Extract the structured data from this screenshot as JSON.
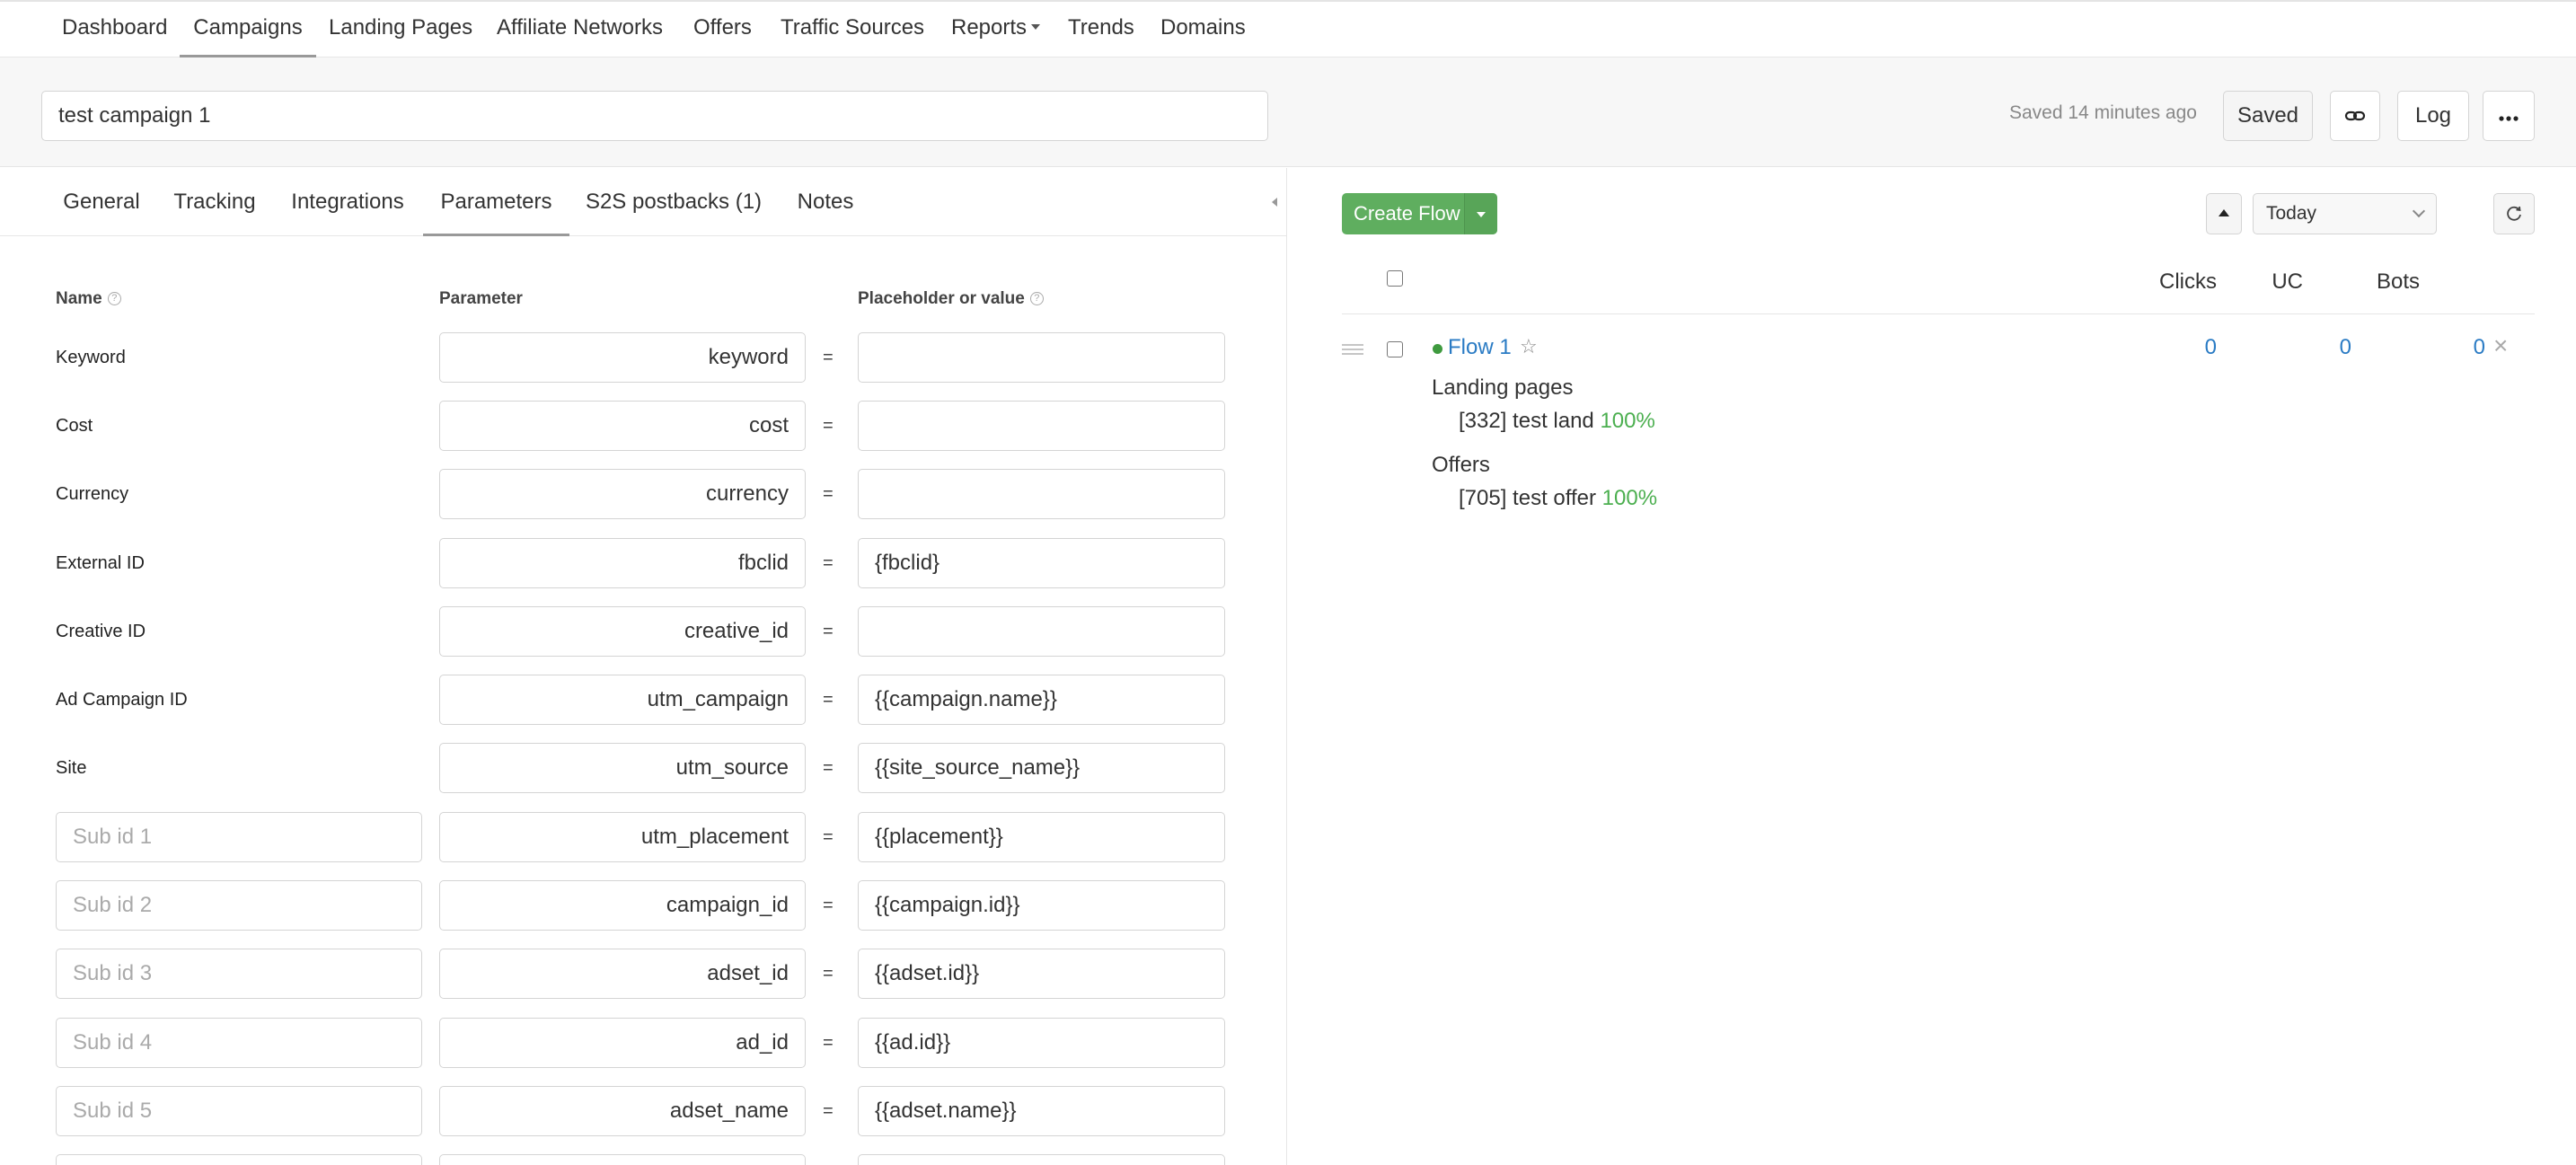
{
  "nav": {
    "items": [
      {
        "label": "Dashboard",
        "active": false
      },
      {
        "label": "Campaigns",
        "active": true
      },
      {
        "label": "Landing Pages",
        "active": false
      },
      {
        "label": "Affiliate Networks",
        "active": false
      },
      {
        "label": "Offers",
        "active": false
      },
      {
        "label": "Traffic Sources",
        "active": false
      },
      {
        "label": "Reports",
        "active": false,
        "dropdown": true
      },
      {
        "label": "Trends",
        "active": false
      },
      {
        "label": "Domains",
        "active": false
      }
    ]
  },
  "header": {
    "campaign_name": "test campaign 1",
    "saved_status": "Saved 14 minutes ago",
    "saved_button": "Saved",
    "link_icon": "link-icon",
    "log_button": "Log",
    "more_icon": "ellipsis-icon"
  },
  "tabs": [
    {
      "label": "General",
      "active": false
    },
    {
      "label": "Tracking",
      "active": false
    },
    {
      "label": "Integrations",
      "active": false
    },
    {
      "label": "Parameters",
      "active": true
    },
    {
      "label": "S2S postbacks (1)",
      "active": false
    },
    {
      "label": "Notes",
      "active": false
    }
  ],
  "params": {
    "headers": {
      "name": "Name",
      "parameter": "Parameter",
      "value": "Placeholder or value"
    },
    "equals": "=",
    "rows": [
      {
        "name": "Keyword",
        "parameter": "keyword",
        "value": ""
      },
      {
        "name": "Cost",
        "parameter": "cost",
        "value": ""
      },
      {
        "name": "Currency",
        "parameter": "currency",
        "value": ""
      },
      {
        "name": "External ID",
        "parameter": "fbclid",
        "value": "{fbclid}"
      },
      {
        "name": "Creative ID",
        "parameter": "creative_id",
        "value": ""
      },
      {
        "name": "Ad Campaign ID",
        "parameter": "utm_campaign",
        "value": "{{campaign.name}}"
      },
      {
        "name": "Site",
        "parameter": "utm_source",
        "value": "{{site_source_name}}"
      },
      {
        "placeholder": "Sub id 1",
        "parameter": "utm_placement",
        "value": "{{placement}}"
      },
      {
        "placeholder": "Sub id 2",
        "parameter": "campaign_id",
        "value": "{{campaign.id}}"
      },
      {
        "placeholder": "Sub id 3",
        "parameter": "adset_id",
        "value": "{{adset.id}}"
      },
      {
        "placeholder": "Sub id 4",
        "parameter": "ad_id",
        "value": "{{ad.id}}"
      },
      {
        "placeholder": "Sub id 5",
        "parameter": "adset_name",
        "value": "{{adset.name}}"
      }
    ]
  },
  "flows": {
    "create_button": "Create Flow",
    "period": "Today",
    "columns": [
      "Clicks",
      "UC",
      "Bots"
    ],
    "items": [
      {
        "name": "Flow 1",
        "status_color": "#3f9a3f",
        "clicks": "0",
        "uc": "0",
        "bots": "0",
        "landing_title": "Landing pages",
        "landing": {
          "text": "[332] test land",
          "pct": "100%"
        },
        "offers_title": "Offers",
        "offer": {
          "text": "[705] test offer",
          "pct": "100%"
        }
      }
    ]
  },
  "colors": {
    "accent_green": "#5fae5f",
    "link_blue": "#2a7bc4",
    "percent_green": "#4caf50"
  }
}
